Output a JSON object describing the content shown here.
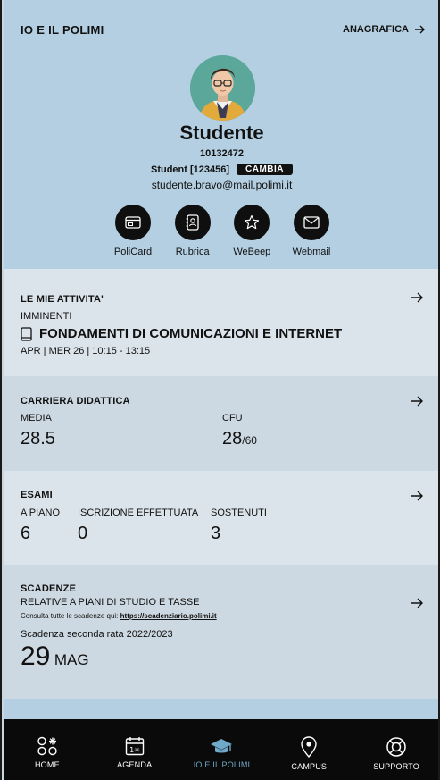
{
  "header": {
    "title": "IO E IL POLIMI",
    "link_label": "ANAGRAFICA"
  },
  "profile": {
    "name": "Studente",
    "matricola": "10132472",
    "role": "Student [123456]",
    "switch_label": "CAMBIA",
    "email": "studente.bravo@mail.polimi.it"
  },
  "shortcuts": [
    {
      "label": "PoliCard",
      "icon": "card-icon"
    },
    {
      "label": "Rubrica",
      "icon": "address-book-icon"
    },
    {
      "label": "WeBeep",
      "icon": "star-icon"
    },
    {
      "label": "Webmail",
      "icon": "mail-icon"
    }
  ],
  "activities": {
    "title": "LE MIE ATTIVITA'",
    "subtitle": "IMMINENTI",
    "course": "FONDAMENTI DI COMUNICAZIONI E INTERNET",
    "schedule": "APR | MER 26 | 10:15 - 13:15"
  },
  "career": {
    "title": "CARRIERA DIDATTICA",
    "media_label": "MEDIA",
    "media_value": "28.5",
    "cfu_label": "CFU",
    "cfu_value": "28",
    "cfu_total": "/60"
  },
  "exams": {
    "title": "ESAMI",
    "planned_label": "A PIANO",
    "planned_value": "6",
    "enrolled_label": "ISCRIZIONE EFFETTUATA",
    "enrolled_value": "0",
    "passed_label": "SOSTENUTI",
    "passed_value": "3"
  },
  "deadlines": {
    "title": "SCADENZE",
    "subtitle": "RELATIVE A PIANI DI STUDIO E TASSE",
    "note": "Consulta tutte le scadenze qui:",
    "link": "https://scadenziario.polimi.it",
    "item": "Scadenza seconda rata 2022/2023",
    "day": "29",
    "month": "MAG"
  },
  "tabs": [
    {
      "label": "HOME",
      "icon": "home-grid-icon",
      "active": false
    },
    {
      "label": "AGENDA",
      "icon": "calendar-icon",
      "active": false
    },
    {
      "label": "IO E IL POLIMI",
      "icon": "graduation-cap-icon",
      "active": true
    },
    {
      "label": "CAMPUS",
      "icon": "map-pin-icon",
      "active": false
    },
    {
      "label": "SUPPORTO",
      "icon": "lifebuoy-icon",
      "active": false
    }
  ],
  "colors": {
    "header_bg": "#b3cfe1",
    "card_light": "#dbe4eb",
    "card_dark": "#cdd9e2",
    "tabbar_bg": "#0a0a0a",
    "active_tab": "#6fa8c8"
  }
}
